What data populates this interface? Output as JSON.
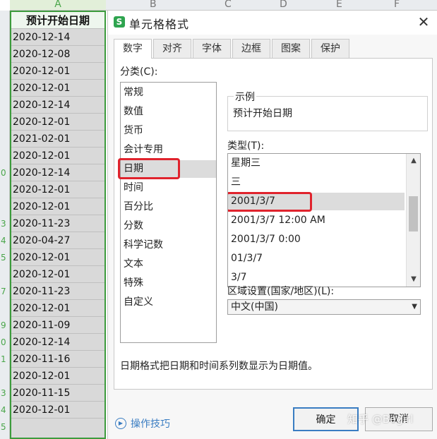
{
  "sheet": {
    "column_labels": [
      "A",
      "B",
      "C",
      "D",
      "E",
      "F"
    ],
    "header_cell": "预计开始日期",
    "dates": [
      "2020-12-14",
      "2020-12-08",
      "2020-12-01",
      "2020-12-01",
      "2020-12-14",
      "2020-12-01",
      "2021-02-01",
      "2020-12-01",
      "2020-12-14",
      "2020-12-01",
      "2020-12-01",
      "2020-11-23",
      "2020-04-27",
      "2020-12-01",
      "2020-12-01",
      "2020-11-23",
      "2020-12-01",
      "2020-11-09",
      "2020-12-14",
      "2020-11-16",
      "2020-12-01",
      "2020-11-15",
      "2020-12-01"
    ],
    "row_numbers": [
      "",
      "",
      "",
      "",
      "",
      "",
      "",
      "",
      "",
      "0",
      "",
      "",
      "3",
      "4",
      "5",
      "",
      "7",
      "",
      "9",
      "0",
      "1",
      "",
      "3",
      "4",
      "5"
    ]
  },
  "dialog": {
    "title": "单元格格式",
    "app_icon": "S",
    "close_icon": "✕",
    "tabs": [
      "数字",
      "对齐",
      "字体",
      "边框",
      "图案",
      "保护"
    ],
    "active_tab": 0,
    "category_label": "分类(C):",
    "categories": [
      "常规",
      "数值",
      "货币",
      "会计专用",
      "日期",
      "时间",
      "百分比",
      "分数",
      "科学记数",
      "文本",
      "特殊",
      "自定义"
    ],
    "selected_category": 4,
    "sample_legend": "示例",
    "sample_value": "预计开始日期",
    "type_label": "类型(T):",
    "types": [
      "星期三",
      "三",
      "2001/3/7",
      "2001/3/7 12:00 AM",
      "2001/3/7 0:00",
      "01/3/7",
      "3/7"
    ],
    "selected_type": 2,
    "locale_label": "区域设置(国家/地区)(L):",
    "locale_value": "中文(中国)",
    "description": "日期格式把日期和时间系列数显示为日期值。",
    "tips_label": "操作技巧",
    "ok_label": "确定",
    "cancel_label": "取消"
  },
  "watermark": "知乎 @Begirl",
  "colors": {
    "highlight_red": "#e0232d",
    "selection_green": "#3c9b3c",
    "link_blue": "#3a7dc2"
  }
}
